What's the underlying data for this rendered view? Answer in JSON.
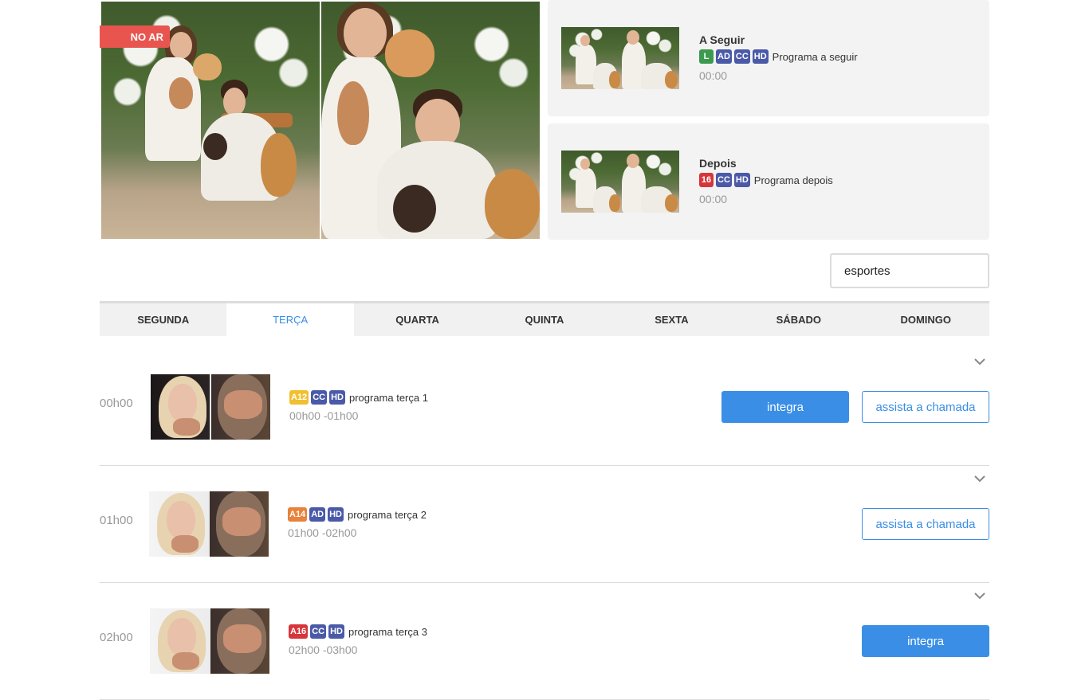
{
  "live": {
    "badge": "NO AR"
  },
  "upcoming": [
    {
      "title": "A Seguir",
      "ratings": [
        {
          "label": "L",
          "color": "#3c9a4f"
        },
        {
          "label": "AD",
          "color": "#4a5aa8"
        },
        {
          "label": "CC",
          "color": "#4a5aa8"
        },
        {
          "label": "HD",
          "color": "#4a5aa8"
        }
      ],
      "program": "Programa a seguir",
      "time": "00:00"
    },
    {
      "title": "Depois",
      "ratings": [
        {
          "label": "16",
          "color": "#d6363b"
        },
        {
          "label": "CC",
          "color": "#4a5aa8"
        },
        {
          "label": "HD",
          "color": "#4a5aa8"
        }
      ],
      "program": "Programa depois",
      "time": "00:00"
    }
  ],
  "search": {
    "value": "esportes"
  },
  "days": [
    "SEGUNDA",
    "TERÇA",
    "QUARTA",
    "QUINTA",
    "SEXTA",
    "SÁBADO",
    "DOMINGO"
  ],
  "active_day": "TERÇA",
  "schedule": [
    {
      "hour": "00h00",
      "ratings": [
        {
          "label": "A12",
          "color": "#f0c030"
        },
        {
          "label": "CC",
          "color": "#4a5aa8"
        },
        {
          "label": "HD",
          "color": "#4a5aa8"
        }
      ],
      "program": "programa terça 1",
      "range": "00h00 -01h00",
      "buttons": [
        "integra",
        "assista a chamada"
      ]
    },
    {
      "hour": "01h00",
      "ratings": [
        {
          "label": "A14",
          "color": "#e9823a"
        },
        {
          "label": "AD",
          "color": "#4a5aa8"
        },
        {
          "label": "HD",
          "color": "#4a5aa8"
        }
      ],
      "program": "programa terça 2",
      "range": "01h00 -02h00",
      "buttons": [
        "assista a chamada"
      ]
    },
    {
      "hour": "02h00",
      "ratings": [
        {
          "label": "A16",
          "color": "#d6363b"
        },
        {
          "label": "CC",
          "color": "#4a5aa8"
        },
        {
          "label": "HD",
          "color": "#4a5aa8"
        }
      ],
      "program": "programa terça 3",
      "range": "02h00 -03h00",
      "buttons": [
        "integra"
      ]
    }
  ]
}
